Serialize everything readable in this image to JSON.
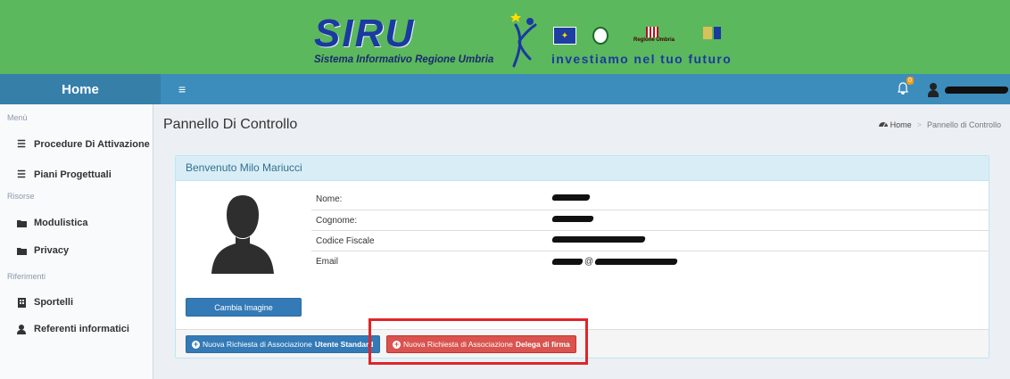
{
  "banner": {
    "logo": "SIRU",
    "logo_subtitle": "Sistema Informativo Regione Umbria",
    "regione_label": "Regione Umbria",
    "tagline": "investiamo nel tuo futuro"
  },
  "topbar": {
    "home_label": "Home",
    "menu_toggle": "≡",
    "notifications_count": "0"
  },
  "sidebar": {
    "sections": [
      {
        "header": "Menù",
        "items": [
          {
            "label": "Procedure Di Attivazione",
            "icon": "list-icon"
          },
          {
            "label": "Piani Progettuali",
            "icon": "list-icon"
          }
        ]
      },
      {
        "header": "Risorse",
        "items": [
          {
            "label": "Modulistica",
            "icon": "folder-icon"
          },
          {
            "label": "Privacy",
            "icon": "folder-icon"
          }
        ]
      },
      {
        "header": "Riferimenti",
        "items": [
          {
            "label": "Sportelli",
            "icon": "building-icon"
          },
          {
            "label": "Referenti informatici",
            "icon": "user-icon"
          }
        ]
      }
    ]
  },
  "page": {
    "title": "Pannello Di Controllo",
    "breadcrumb": [
      {
        "label": "Home",
        "icon": "dashboard-icon"
      },
      {
        "label": "Pannello di Controllo"
      }
    ]
  },
  "panel": {
    "heading": "Benvenuto Milo Mariucci",
    "change_image_label": "Cambia Imagine",
    "fields": [
      {
        "label": "Nome:"
      },
      {
        "label": "Cognome:"
      },
      {
        "label": "Codice Fiscale"
      },
      {
        "label": "Email"
      }
    ],
    "email_at": "@",
    "actions": {
      "standard_prefix": "Nuova Richiesta di Associazione",
      "standard_bold": "Utente Standard",
      "delega_prefix": "Nuova Richiesta di Associazione",
      "delega_bold": "Delega di firma"
    }
  },
  "colors": {
    "banner": "#5cb85c",
    "topbar": "#3c8dbc",
    "primary": "#337ab7",
    "danger": "#d9534f",
    "highlight": "#e0242a"
  }
}
